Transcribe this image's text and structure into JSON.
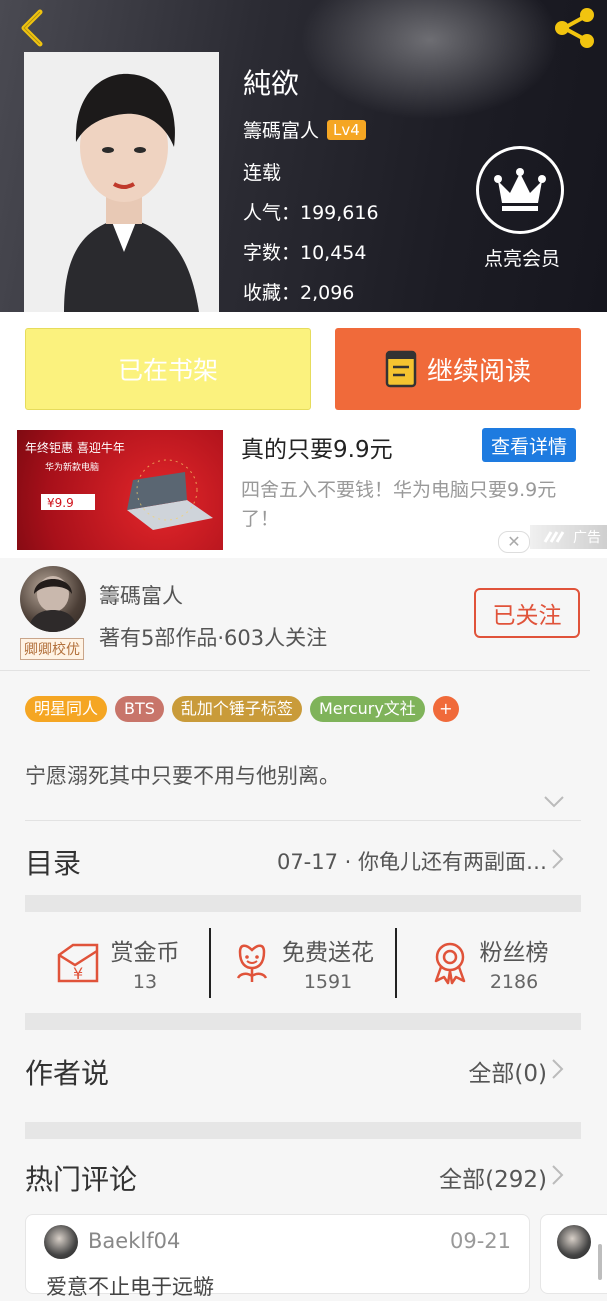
{
  "book": {
    "title": "純欲",
    "author": "籌碼富人",
    "level": "Lv4",
    "status": "连载",
    "popularity": "人气：199,616",
    "word_count": "字数：10,454",
    "favorites": "收藏：2,096",
    "vip_label": "点亮会员"
  },
  "actions": {
    "shelf_label": "已在书架",
    "read_label": "继续阅读"
  },
  "ad": {
    "title": "真的只要9.9元",
    "button": "查看详情",
    "description": "四舍五入不要钱！华为电脑只要9.9元了！",
    "close": "✕",
    "label": "广告",
    "image_line1": "年终钜惠 喜迎牛年",
    "image_line2": "华为新款电脑",
    "image_price": "¥9.9"
  },
  "author_card": {
    "name": "籌碼富人",
    "stats": "著有5部作品·603人关注",
    "badge": "卿卿校优",
    "follow_label": "已关注"
  },
  "tags": [
    {
      "label": "明星同人",
      "color": "#f5a623"
    },
    {
      "label": "BTS",
      "color": "#c8756a"
    },
    {
      "label": "乱加个锤子标签",
      "color": "#c99b3a"
    },
    {
      "label": "Mercury文社",
      "color": "#7fb35a"
    },
    {
      "label": "+",
      "color": "#f06a3a"
    }
  ],
  "intro": "宁愿溺死其中只要不用与他别离。",
  "directory": {
    "label": "目录",
    "latest": "07-17 · 你龟儿还有两副面…"
  },
  "stats": [
    {
      "label": "赏金币",
      "value": "13",
      "icon": "reward-coin-icon"
    },
    {
      "label": "免费送花",
      "value": "1591",
      "icon": "flower-icon"
    },
    {
      "label": "粉丝榜",
      "value": "2186",
      "icon": "medal-icon"
    }
  ],
  "author_says": {
    "title": "作者说",
    "all": "全部(0)"
  },
  "hot_comments": {
    "title": "热门评论",
    "all": "全部(292)",
    "items": [
      {
        "user": "Baeklf04",
        "date": "09-21",
        "text": "爱意不止电于远蝣"
      }
    ]
  },
  "colors": {
    "accent": "#f06a3a",
    "shelf": "#fbf27e",
    "ad_button": "#1e7be0",
    "follow": "#e0533a",
    "icon_red": "#e0533a"
  }
}
